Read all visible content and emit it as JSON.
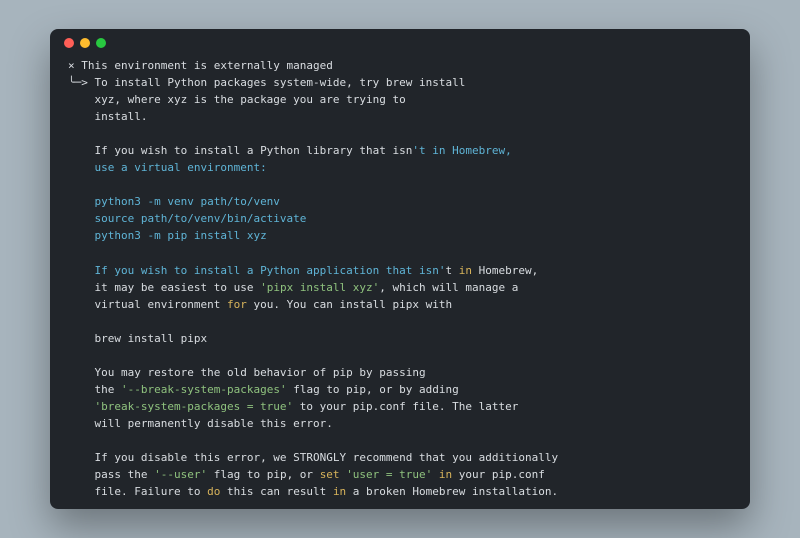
{
  "window": {
    "dots": [
      "close",
      "minimize",
      "zoom"
    ]
  },
  "lines": {
    "l0_prefix": "×",
    "l0": "This environment is externally managed",
    "l1_prefix": "╰─>",
    "l1": "To install Python packages system-wide, try brew install",
    "l2": "xyz, where xyz is the package you are trying to",
    "l3": "install.",
    "l4a": "If you wish to install a Python library that isn",
    "l4b": "'t in Homebrew,",
    "l4c": "use a virtual environment:",
    "l5": "python3 -m venv path/to/venv",
    "l6": "source path/to/venv/bin/activate",
    "l7": "python3 -m pip install xyz",
    "l8a": "If you wish to install a Python application that isn'",
    "l8b": "t ",
    "l8c": "in",
    "l8d": " Homebrew,",
    "l9a": "it may be easiest to use ",
    "l9b": "'pipx install xyz'",
    "l9c": ", which will manage a",
    "l10a": "virtual environment ",
    "l10b": "for",
    "l10c": " you. You can install pipx with",
    "l11": "brew install pipx",
    "l12": "You may restore the old behavior of pip by passing",
    "l13a": "the ",
    "l13b": "'--break-system-packages'",
    "l13c": " flag to pip, or by adding",
    "l14a": "'break-system-packages = true'",
    "l14b": " to your pip.conf file. The latter",
    "l15": "will permanently disable this error.",
    "l16": "If you disable this error, we STRONGLY recommend that you additionally",
    "l17a": "pass the ",
    "l17b": "'--user'",
    "l17c": " flag to pip, or ",
    "l17d": "set",
    "l17e": " ",
    "l17f": "'user = true'",
    "l17g": " ",
    "l17h": "in",
    "l17i": " your pip.conf",
    "l18a": "file. Failure to ",
    "l18b": "do",
    "l18c": " this can result ",
    "l18d": "in",
    "l18e": " a broken Homebrew installation."
  }
}
